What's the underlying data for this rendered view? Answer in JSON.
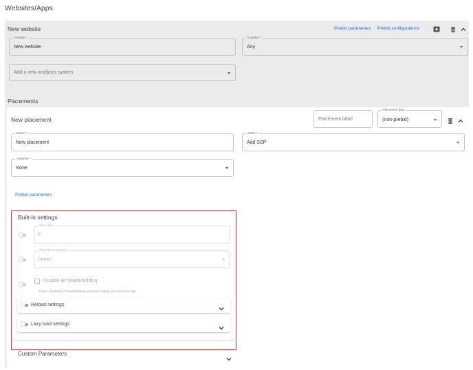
{
  "breadcrumb": "Websites/Apps",
  "website": {
    "name": "New website",
    "links": {
      "prebid_parameters": "Prebid parameters",
      "prebid_configurations": "Prebid configurations"
    },
    "icons": {
      "add": "add-box-icon",
      "delete": "trash-icon",
      "collapse": "chevron-up-icon"
    },
    "domain": {
      "label": "Domain *",
      "value": "New website"
    },
    "country": {
      "label": "Country *",
      "value": "Any"
    },
    "analytics": {
      "placeholder": "Add a new analytics system"
    }
  },
  "placements": {
    "title": "Placements",
    "placement": {
      "name": "New placement",
      "label_input": {
        "placeholder": "Placement label"
      },
      "type": {
        "label": "Placement type",
        "value": "(non-prebid)"
      },
      "name_field": {
        "label": "Name *",
        "value": "New placement"
      },
      "ssps": {
        "label": "SSPs *",
        "value": "Add SSP"
      },
      "adserver": {
        "label": "Adserver *",
        "value": "None"
      },
      "prebid_link": "Prebid parameters",
      "builtin": {
        "title": "Built-in settings",
        "price_floor": {
          "label": "Price floor",
          "value": "0"
        },
        "price_floor_currency": {
          "label": "Price floor currency",
          "value": "(none)"
        },
        "disable_hb": {
          "label": "Disable all headerbidding",
          "notice": "Notice: Disabling of headerbidding using this setting only works for web"
        },
        "reload": {
          "label": "Reload settings"
        },
        "lazy": {
          "label": "Lazy load settings"
        }
      },
      "custom_params": {
        "label": "Custom Parameters"
      }
    }
  },
  "colors": {
    "link": "#1e6fd9",
    "highlight": "#e0342f",
    "panel": "#ebebeb"
  }
}
